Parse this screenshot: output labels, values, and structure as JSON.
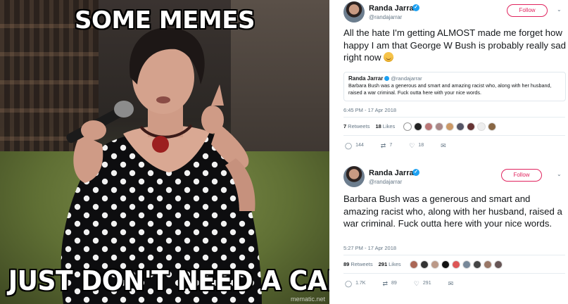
{
  "meme": {
    "top_text": "SOME MEMES",
    "bottom_text": "JUST DON'T NEED A CAPTION",
    "watermark": "mematic.net"
  },
  "tweet1": {
    "name": "Randa Jarrar",
    "handle": "@randajarrar",
    "follow_label": "Follow",
    "text": "All the hate I'm getting ALMOST made me forget how happy I am that George W Bush is probably really sad right now",
    "emoji_icon": "smiling-face-emoji",
    "quote": {
      "name": "Randa Jarrar",
      "handle": "@randajarrar",
      "text": "Barbara Bush was a generous and smart and amazing racist who, along with her husband, raised a war criminal. Fuck outta here with your nice words."
    },
    "time": "6:45 PM - 17 Apr 2018",
    "retweets_count": "7",
    "retweets_label": "Retweets",
    "likes_count": "18",
    "likes_label": "Likes",
    "replies": "144",
    "retweets_action": "7",
    "likes_action": "18"
  },
  "tweet2": {
    "name": "Randa Jarrar",
    "handle": "@randajarrar",
    "follow_label": "Follow",
    "text": "Barbara Bush was a generous and smart and amazing racist who, along with her husband, raised a war criminal. Fuck outta here with your nice words.",
    "time": "5:27 PM - 17 Apr 2018",
    "retweets_count": "89",
    "retweets_label": "Retweets",
    "likes_count": "291",
    "likes_label": "Likes",
    "replies": "1.7K",
    "retweets_action": "89",
    "likes_action": "291"
  },
  "colors": {
    "follow": "#e0245e",
    "verified": "#1da1f2",
    "text": "#14171a",
    "muted": "#657786"
  }
}
